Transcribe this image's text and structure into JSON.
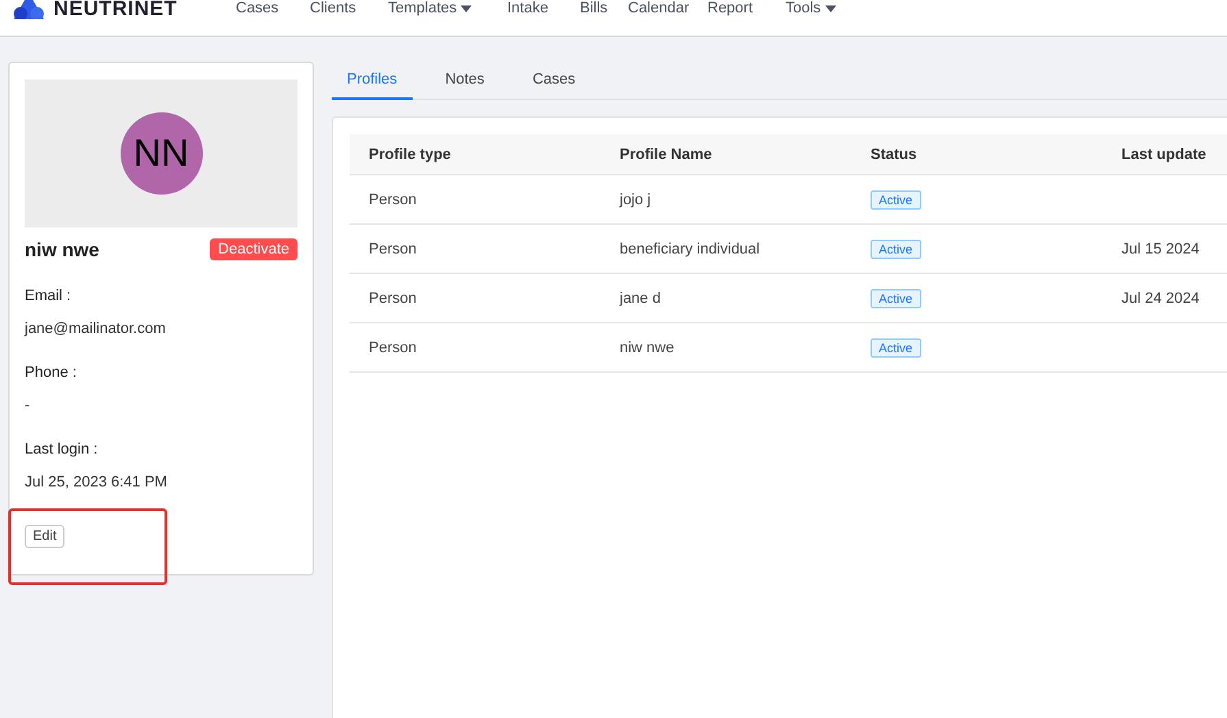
{
  "nav": {
    "brand": "NEUTRINET",
    "items": [
      {
        "label": "Cases",
        "dropdown": false
      },
      {
        "label": "Clients",
        "dropdown": false
      },
      {
        "label": "Templates",
        "dropdown": true
      },
      {
        "label": "Intake",
        "dropdown": false
      },
      {
        "label": "Bills",
        "dropdown": false
      },
      {
        "label": "Calendar",
        "dropdown": false
      },
      {
        "label": "Report",
        "dropdown": false
      },
      {
        "label": "Tools",
        "dropdown": true
      }
    ]
  },
  "profile": {
    "initials": "NN",
    "name": "niw nwe",
    "action": "Deactivate",
    "fields": [
      {
        "label": "Email :",
        "value": "jane@mailinator.com"
      },
      {
        "label": "Phone :",
        "value": "-"
      },
      {
        "label": "Last login :",
        "value": "Jul 25, 2023 6:41 PM"
      }
    ],
    "edit": "Edit",
    "highlighted": true
  },
  "tabs": [
    {
      "label": "Profiles",
      "selected": true
    },
    {
      "label": "Notes",
      "selected": false
    },
    {
      "label": "Cases",
      "selected": false
    }
  ],
  "table": {
    "columns": [
      "Profile type",
      "Profile Name",
      "Status",
      "Last update"
    ],
    "rows": [
      {
        "type": "Person",
        "name": "jojo j",
        "status": "Active"
      },
      {
        "type": "Person",
        "name": "beneficiary individual",
        "status": "Active",
        "updated": "Jul 15 2024"
      },
      {
        "type": "Person",
        "name": "jane d",
        "status": "Active",
        "updated": "Jul 24 2024"
      },
      {
        "type": "Person",
        "name": "niw nwe",
        "status": "Active"
      }
    ]
  }
}
